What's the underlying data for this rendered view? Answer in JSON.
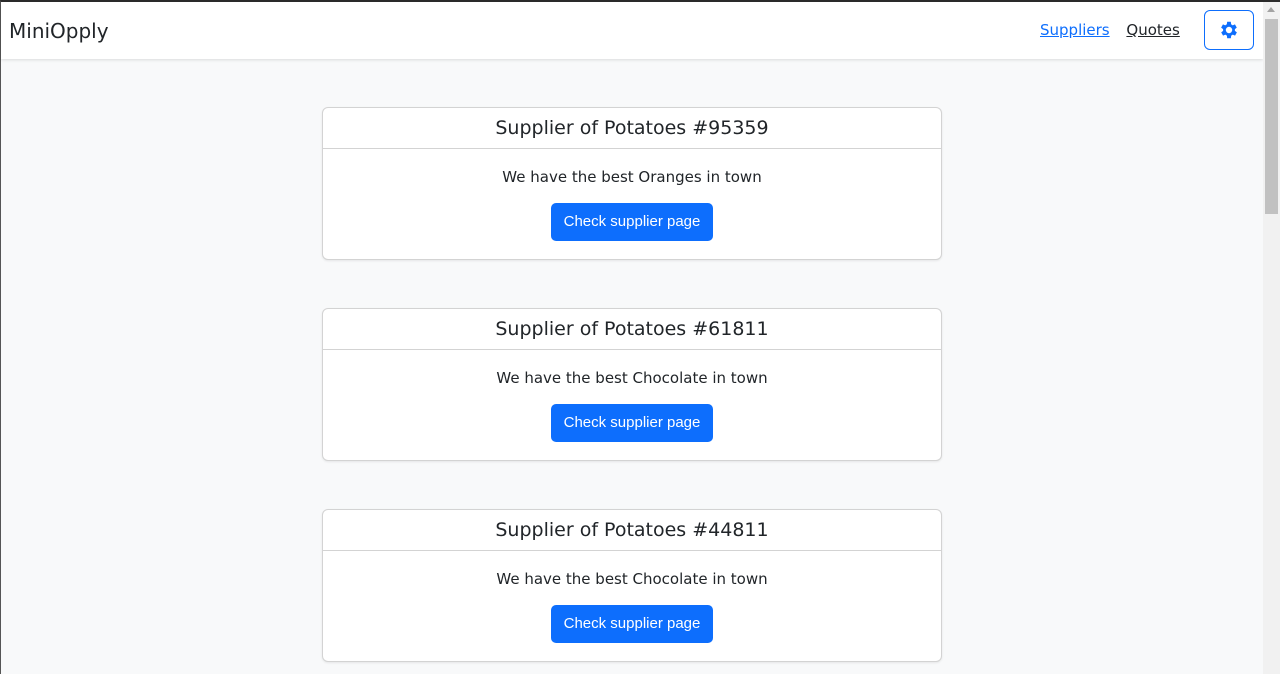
{
  "navbar": {
    "brand": "MiniOpply",
    "links": [
      {
        "label": "Suppliers"
      },
      {
        "label": "Quotes"
      }
    ],
    "settings_icon": "gear-icon",
    "accent": "#0d6efd"
  },
  "suppliers": [
    {
      "title": "Supplier of Potatoes #95359",
      "description": "We have the best Oranges in town",
      "button": "Check supplier page"
    },
    {
      "title": "Supplier of Potatoes #61811",
      "description": "We have the best Chocolate in town",
      "button": "Check supplier page"
    },
    {
      "title": "Supplier of Potatoes #44811",
      "description": "We have the best Chocolate in town",
      "button": "Check supplier page"
    }
  ]
}
